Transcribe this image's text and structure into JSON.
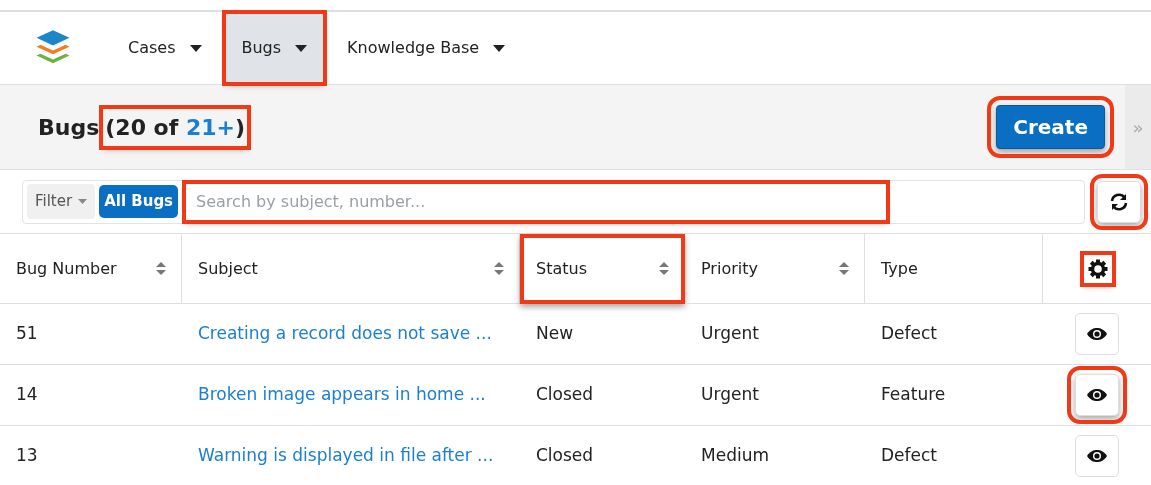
{
  "nav": {
    "tabs": [
      {
        "label": "Cases",
        "selected": false,
        "highlighted": false
      },
      {
        "label": "Bugs",
        "selected": true,
        "highlighted": true
      },
      {
        "label": "Knowledge Base",
        "selected": false,
        "highlighted": false
      }
    ]
  },
  "header": {
    "title": "Bugs",
    "count_prefix": "(20 of ",
    "count_total": "21+",
    "count_suffix": ")",
    "count_highlighted": true,
    "create_button": "Create",
    "create_highlighted": true,
    "collapse_glyph": "»"
  },
  "filter": {
    "label": "Filter",
    "chip": "All Bugs",
    "placeholder": "Search by subject, number...",
    "search_highlighted": true,
    "refresh_highlighted": true
  },
  "table": {
    "columns": [
      {
        "label": "Bug Number",
        "sortable": true,
        "highlighted": false
      },
      {
        "label": "Subject",
        "sortable": true,
        "highlighted": false
      },
      {
        "label": "Status",
        "sortable": true,
        "highlighted": true
      },
      {
        "label": "Priority",
        "sortable": true,
        "highlighted": false
      },
      {
        "label": "Type",
        "sortable": false,
        "highlighted": false
      }
    ],
    "settings_highlighted": true,
    "rows": [
      {
        "cells": [
          "51",
          "Creating a record does not save ...",
          "New",
          "Urgent",
          "Defect"
        ],
        "preview_highlighted": false
      },
      {
        "cells": [
          "14",
          "Broken image appears in home ...",
          "Closed",
          "Urgent",
          "Feature"
        ],
        "preview_highlighted": true
      },
      {
        "cells": [
          "13",
          "Warning is displayed in file after ...",
          "Closed",
          "Medium",
          "Defect"
        ],
        "preview_highlighted": false
      }
    ]
  }
}
